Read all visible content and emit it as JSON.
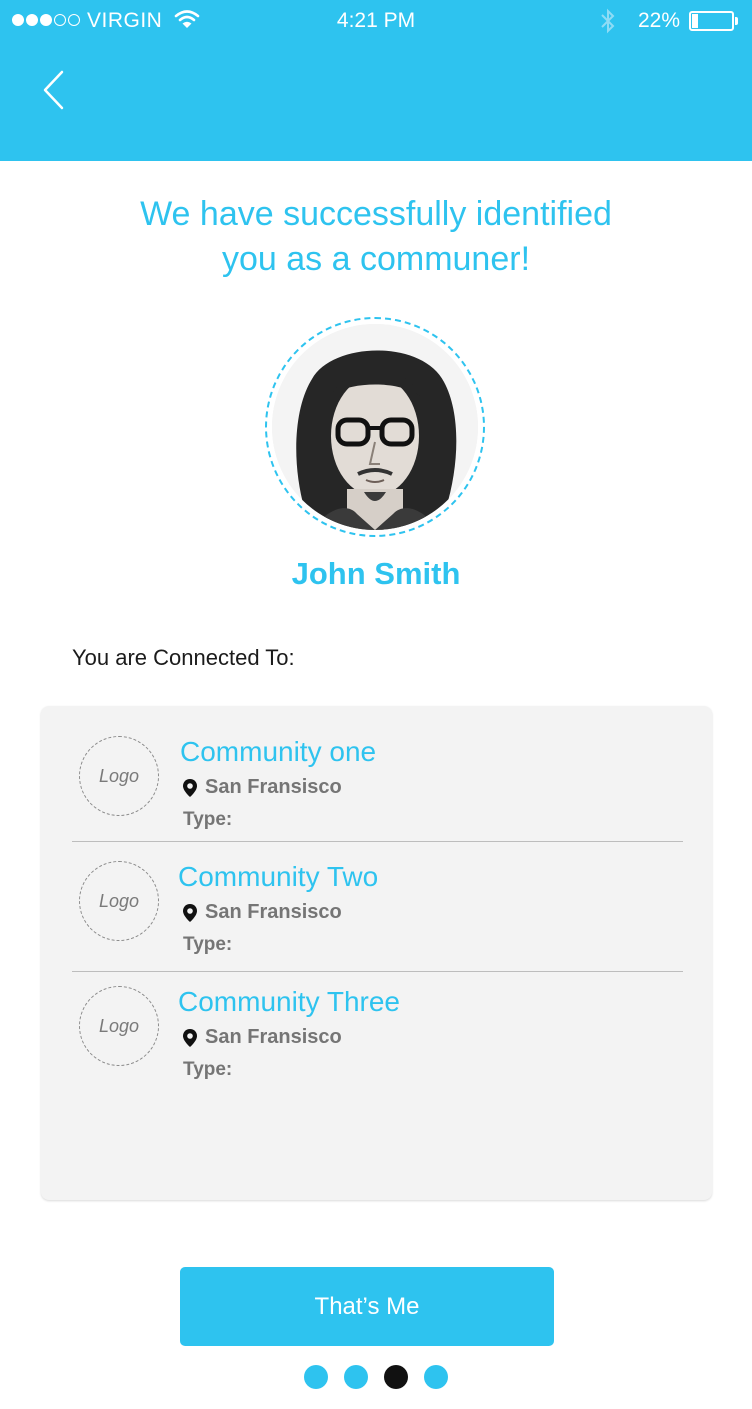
{
  "status_bar": {
    "carrier": "VIRGIN",
    "time": "4:21 PM",
    "battery": "22%",
    "battery_level": 0.22,
    "signal_filled": 3,
    "signal_total": 5
  },
  "header": {
    "back_icon": "chevron-left-icon"
  },
  "headline": "We have successfully identified\nyou as a communer!",
  "user": {
    "name": "John Smith",
    "avatar_icon": "avatar-portrait"
  },
  "connections": {
    "label": "You are Connected To:",
    "items": [
      {
        "name": "Community one",
        "logo": "Logo",
        "location": "San Fransisco",
        "type": "Type:"
      },
      {
        "name": "Community Two",
        "logo": "Logo",
        "location": "San Fransisco",
        "type": "Type:"
      },
      {
        "name": "Community Three",
        "logo": "Logo",
        "location": "San Fransisco",
        "type": "Type:"
      }
    ]
  },
  "cta": {
    "label": "That’s Me"
  },
  "pager": {
    "count": 4,
    "active_index": 2
  },
  "colors": {
    "accent": "#2ec3ef",
    "panel": "#f3f3f3",
    "active_dot": "#111111"
  }
}
